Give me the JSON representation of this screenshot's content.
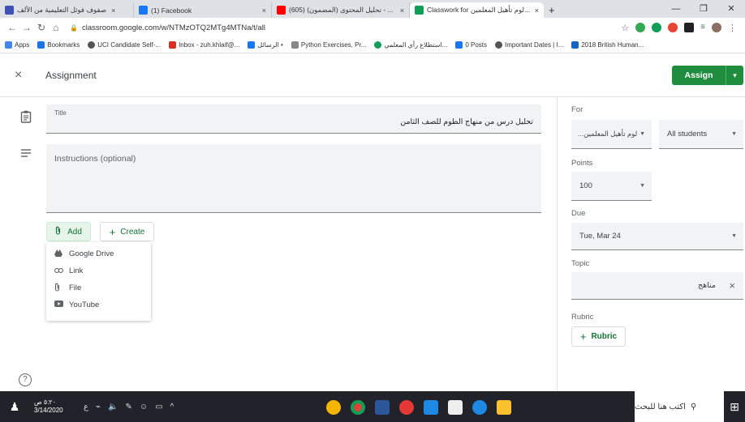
{
  "browser": {
    "tabs": [
      {
        "label": "صفوف فوثل التعليمية من الألف",
        "color": "#3f51b5",
        "active": false
      },
      {
        "label": "(1) Facebook",
        "color": "#1877f2",
        "active": false
      },
      {
        "label": "(605) تحليل المحتوى (المضمون) - ...",
        "color": "#ff0000",
        "active": false
      },
      {
        "label": "Classwork for لوم تأهيل المعلمين...",
        "color": "#0f9d58",
        "active": true
      }
    ],
    "new_tab": "+",
    "url": "classroom.google.com/w/NTMzOTQ2MTg4MTNa/t/all",
    "bookmarks": [
      {
        "label": "Apps",
        "color": "#4285f4"
      },
      {
        "label": "Bookmarks",
        "color": "#1a73e8"
      },
      {
        "label": "UCI Candidate Self-...",
        "color": "#555555"
      },
      {
        "label": "Inbox - zuh.khlaif@...",
        "color": "#d93025"
      },
      {
        "label": "الرسائل •",
        "color": "#1877f2"
      },
      {
        "label": "Python Exercises, Pr...",
        "color": "#888888"
      },
      {
        "label": "استطلاع رأي المعلمي...",
        "color": "#0f9d58"
      },
      {
        "label": "0 Posts",
        "color": "#1877f2"
      },
      {
        "label": "Important Dates | I...",
        "color": "#555555"
      },
      {
        "label": "2018 British Human...",
        "color": "#1565c0"
      }
    ]
  },
  "header": {
    "close_icon": "×",
    "title": "Assignment",
    "assign_label": "Assign",
    "assign_caret": "▾"
  },
  "form": {
    "title_label": "Title",
    "title_value": "تحليل درس من منهاج الطوم للصف الثامن",
    "instructions_placeholder": "Instructions (optional)",
    "add_label": "Add",
    "create_label": "Create"
  },
  "add_menu": {
    "items": [
      {
        "label": "Google Drive",
        "icon": "drive-icon"
      },
      {
        "label": "Link",
        "icon": "link-icon"
      },
      {
        "label": "File",
        "icon": "paperclip-icon"
      },
      {
        "label": "YouTube",
        "icon": "youtube-icon"
      }
    ]
  },
  "side": {
    "for_label": "For",
    "class_value": "...لوم تأهيل المعلمين",
    "students_value": "All students",
    "points_label": "Points",
    "points_value": "100",
    "due_label": "Due",
    "due_value": "Tue, Mar 24",
    "topic_label": "Topic",
    "topic_value": "مناهج",
    "rubric_label": "Rubric",
    "rubric_button": "Rubric"
  },
  "taskbar": {
    "time": "٥:٢٠ ص",
    "date": "3/14/2020",
    "lang": "ع",
    "search_text": "اكتب هنا للبحث"
  },
  "colors": {
    "accent_green": "#1e8e3e",
    "field_bg": "#f1f3f4"
  }
}
